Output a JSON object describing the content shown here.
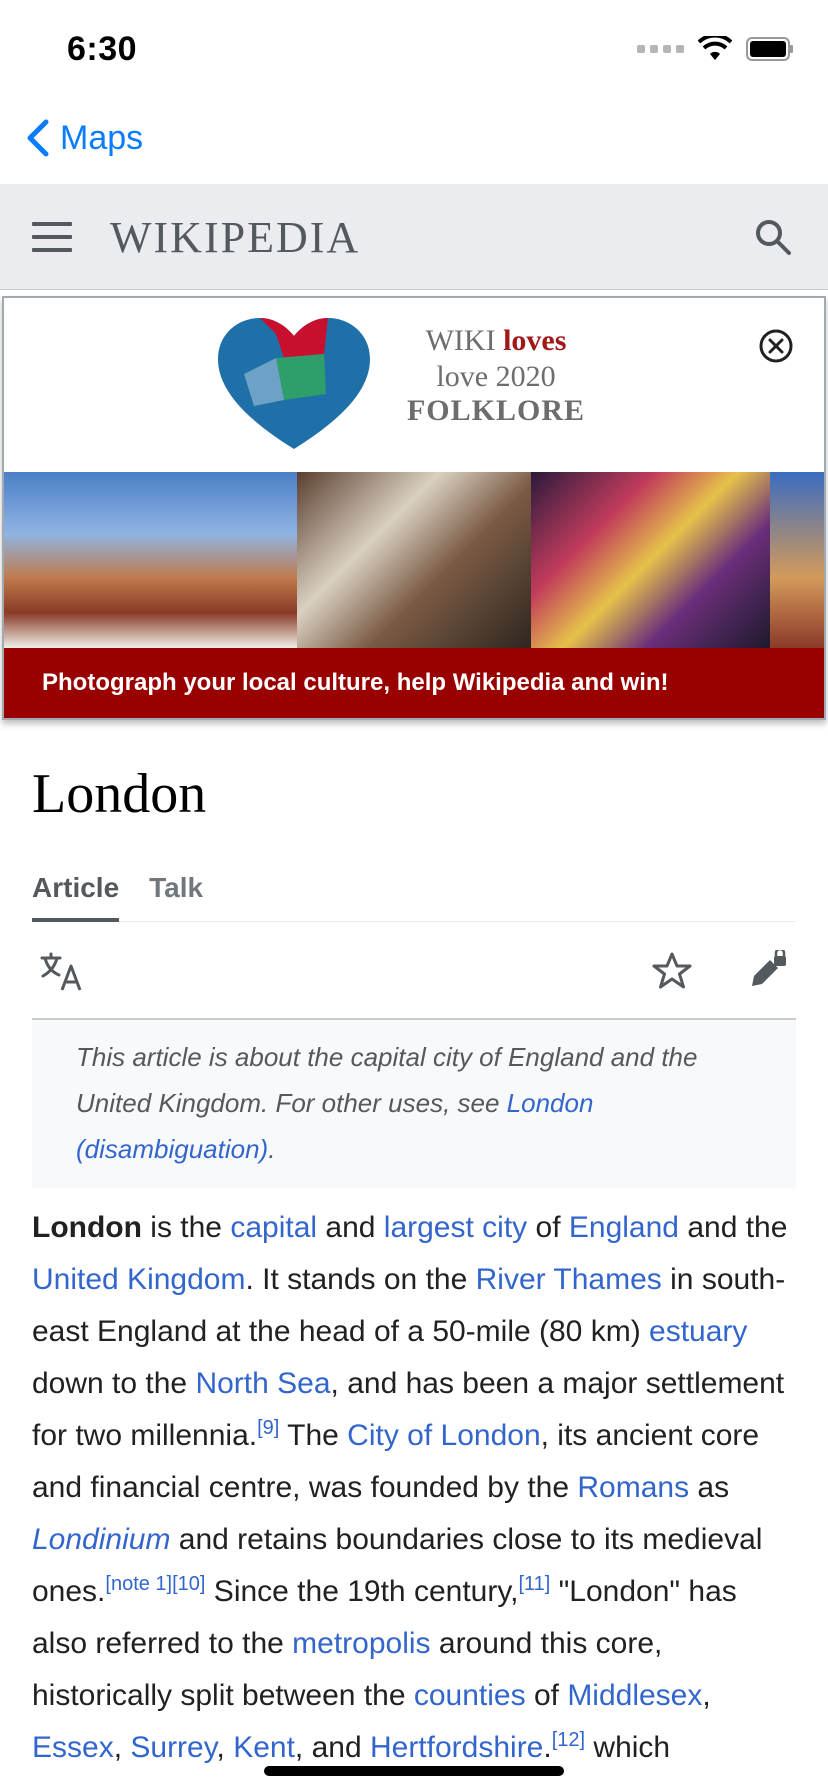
{
  "status_bar": {
    "time": "6:30"
  },
  "nav": {
    "back_label": "Maps"
  },
  "header": {
    "wordmark": "WIKIPEDIA"
  },
  "banner": {
    "line1_prefix": "WIKI",
    "line1_bold": "loves",
    "line2": "love 2020",
    "line3": "FOLKLORE",
    "cta": "Photograph your local culture, help Wikipedia and win!"
  },
  "article": {
    "title": "London",
    "tabs": [
      {
        "label": "Article"
      },
      {
        "label": "Talk"
      }
    ],
    "hatnote": {
      "text": "This article is about the capital city of England and the United Kingdom. For other uses, see ",
      "link": "London (disambiguation)",
      "suffix": "."
    },
    "lead": {
      "s1_bold": "London",
      "s1_a": " is the ",
      "l_capital": "capital",
      "s1_b": " and ",
      "l_largest": "largest city",
      "s1_c": " of ",
      "l_england": "England",
      "s1_d": " and the ",
      "l_uk": "United Kingdom",
      "s1_e": ". It stands on the ",
      "l_thames": "River Thames",
      "s1_f": " in south-east England at the head of a 50-mile (80 km) ",
      "l_estuary": "estuary",
      "s1_g": " down to the ",
      "l_northsea": "North Sea",
      "s1_h": ", and has been a major settlement for two millennia.",
      "ref9": "[9]",
      "s2_a": " The ",
      "l_city": "City of London",
      "s2_b": ", its ancient core and financial centre, was founded by the ",
      "l_romans": "Romans",
      "s2_c": " as ",
      "l_londinium": "Londinium",
      "s2_d": " and retains boundaries close to its medieval ones.",
      "ref_note1": "[note 1]",
      "ref10": "[10]",
      "s3_a": " Since the 19th century,",
      "ref11": "[11]",
      "s3_b": " \"London\" has also referred to the ",
      "l_metropolis": "metropolis",
      "s3_c": " around this core, historically split between the ",
      "l_counties": "counties",
      "s3_d": " of ",
      "l_middlesex": "Middlesex",
      "s3_e": ", ",
      "l_essex": "Essex",
      "s3_f": ", ",
      "l_surrey": "Surrey",
      "s3_g": ", ",
      "l_kent": "Kent",
      "s3_h": ", and ",
      "l_herts": "Hertfordshire",
      "s3_i": ".",
      "ref12": "[12]",
      "s3_j": " which"
    }
  },
  "icons": {
    "back": "chevron-left-icon",
    "menu": "hamburger-menu-icon",
    "search": "search-icon",
    "close": "close-circle-icon",
    "language": "language-icon",
    "watch": "star-icon",
    "edit": "edit-locked-icon"
  },
  "colors": {
    "ios_blue": "#0a7cff",
    "link": "#3366cc",
    "banner_red": "#990000",
    "header_bg": "#eaecf0"
  }
}
